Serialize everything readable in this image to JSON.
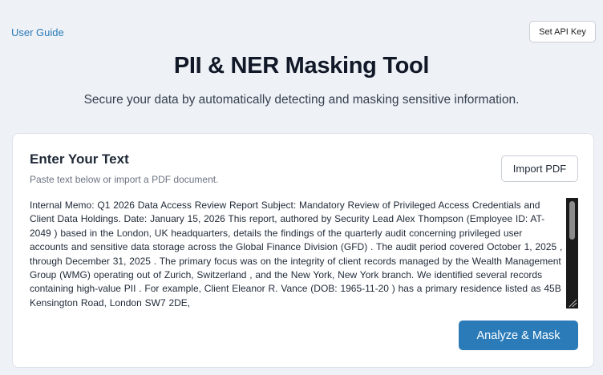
{
  "header": {
    "user_guide_label": "User Guide",
    "api_key_label": "Set API Key",
    "title": "PII & NER Masking Tool",
    "subtitle": "Secure your data by automatically detecting and masking sensitive information."
  },
  "input_card": {
    "title": "Enter Your Text",
    "hint": "Paste text below or import a PDF document.",
    "import_label": "Import PDF",
    "text_value": "Internal Memo: Q1 2026 Data Access Review Report  Subject:   Mandatory Review of Privileged Access Credentials and Client Data Holdings.  Date:   January 15, 2026  This report, authored by   Security Lead Alex Thompson (Employee ID:   AT-2049 ) based in the  London, UK   headquarters, details the findings of the   quarterly audit concerning privileged user  accounts and sensitive data storage across the   Global   Finance Division (GFD) . The audit  period covered   October 1, 2025 , through   December 31,   2025 .  The primary focus was on the integrity of client records managed by the   Wealth Management  Group (WMG)   operating out of   Zurich, Switzerland ,   and the   New York, New York   branch.  We identified several records containing high-value   PII . For example, Client Eleanor R. Vance  (DOB:   1965-11-20 ) has a primary residence listed as   45B Kensington Road, London SW7  2DE,",
    "analyze_label": "Analyze & Mask"
  },
  "colors": {
    "accent": "#2b7bb9",
    "background": "#eef1f6",
    "card": "#ffffff"
  }
}
